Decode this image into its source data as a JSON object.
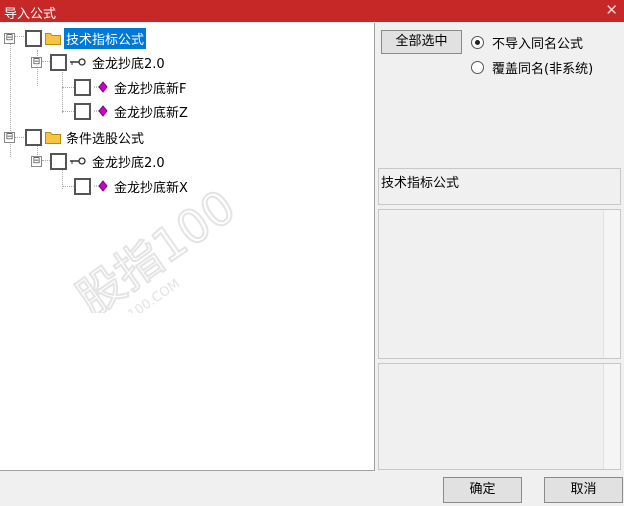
{
  "window": {
    "title": "导入公式",
    "close_glyph": "✕"
  },
  "tree": {
    "nodes": [
      {
        "label": "技术指标公式",
        "expander": "⊟",
        "icon": "folder-icon",
        "selected": true
      },
      {
        "label": "金龙抄底2.0",
        "expander": "⊟",
        "icon": "key-icon"
      },
      {
        "label": "金龙抄底新F",
        "icon": "formula-icon"
      },
      {
        "label": "金龙抄底新Z",
        "icon": "formula-icon"
      },
      {
        "label": "条件选股公式",
        "expander": "⊟",
        "icon": "folder-icon"
      },
      {
        "label": "金龙抄底2.0",
        "expander": "⊟",
        "icon": "key-icon"
      },
      {
        "label": "金龙抄底新X",
        "icon": "formula-icon"
      }
    ]
  },
  "options": {
    "select_all_label": "全部选中",
    "radio_no_import_label": "不导入同名公式",
    "radio_overwrite_label": "覆盖同名(非系统)",
    "selected_radio": "no_import"
  },
  "detail": {
    "formula_name": "技术指标公式"
  },
  "buttons": {
    "ok_label": "确定",
    "cancel_label": "取消"
  },
  "watermark": {
    "brand_text": "股指100",
    "url_text": "GUZHI100.COM"
  },
  "colors": {
    "title_bar": "#c62828",
    "selection": "#0078d7",
    "folder": "#f5c542",
    "formula": "#cc00cc"
  }
}
